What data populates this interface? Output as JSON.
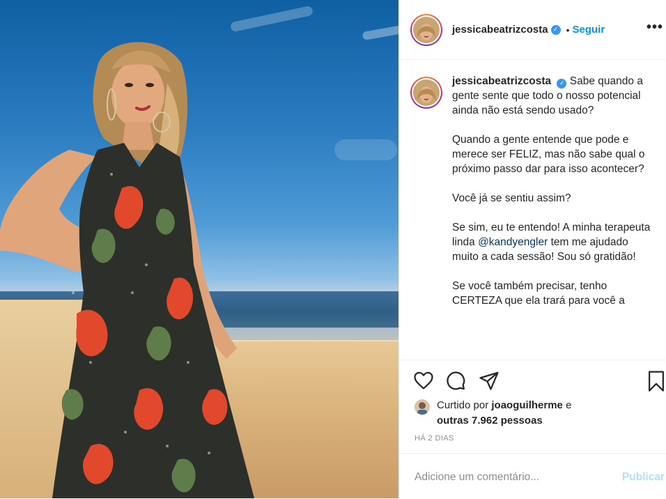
{
  "header": {
    "username": "jessicabeatrizcosta",
    "verified_glyph": "✓",
    "separator": "•",
    "follow_label": "Seguir",
    "more_glyph": "•••"
  },
  "caption": {
    "username": "jessicabeatrizcosta",
    "paragraphs": [
      "Sabe quando a gente sente que todo o nosso potencial ainda não está sendo usado?",
      "Quando a gente entende que pode e merece ser FELIZ, mas não sabe qual o próximo passo dar para isso acontecer?",
      "Você já se sentiu assim?",
      "Se sim, eu te entendo! A minha terapeuta linda",
      "@kandyengler",
      "tem me ajudado muito a cada sessão! Sou só gratidão!",
      "Se você também precisar, tenho CERTEZA que ela trará para você a"
    ]
  },
  "actions": {
    "icons": [
      "heart-icon",
      "comment-icon",
      "share-icon",
      "bookmark-icon"
    ]
  },
  "likes": {
    "prefix": "Curtido por",
    "user": "joaoguilherme",
    "connector": "e",
    "others": "outras 7.962 pessoas"
  },
  "timestamp": "HÁ 2 DIAS",
  "comment": {
    "placeholder": "Adicione um comentário...",
    "publish_label": "Publicar"
  },
  "colors": {
    "link": "#0095f6",
    "verified": "#3897f0",
    "muted": "#8e8e8e",
    "publish_disabled": "#b2dffc"
  }
}
